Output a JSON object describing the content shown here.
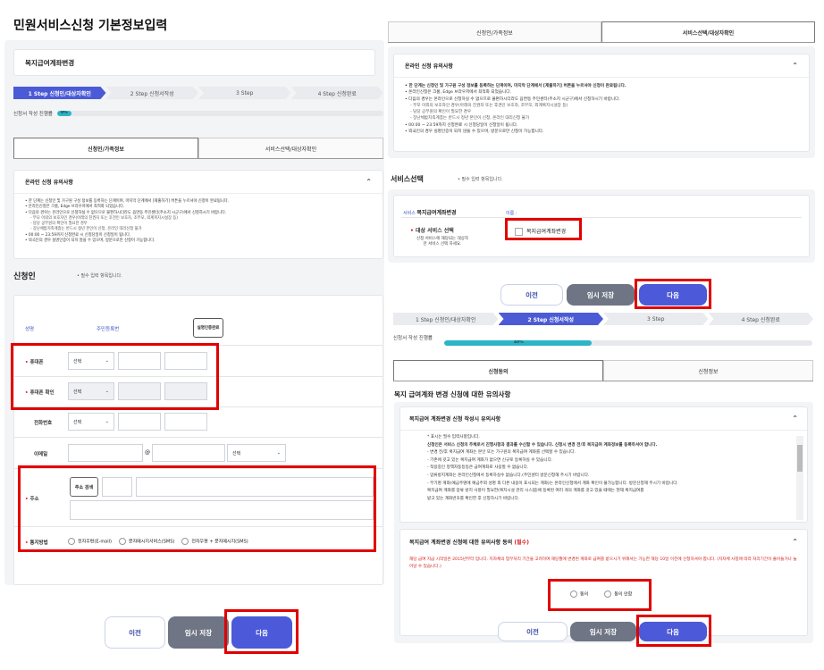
{
  "left": {
    "page_title": "민원서비스신청 기본정보입력",
    "service_name": "복지급여계좌변경",
    "steps": [
      "1 Step 신청인/대상자확인",
      "2 Step 신청서작성",
      "3 Step",
      "4 Step 신청완료"
    ],
    "progress_label": "신청서 작성 진행률",
    "progress_value": "0%",
    "tabs": [
      "신청인/가족정보",
      "서비스선택/대상자확인"
    ],
    "notice_title": "온라인 신청 유의사항",
    "notice_lines": [
      "한 단계는 신청인 및 가구원 구성 정보를 등록하는 단계이며, 마지막 단계에서 [제출하기] 버튼을 누르셔야 신청이 완료됩니다.",
      "온라인신청은 크롬, Edge 브라우저에서 최적화 되었습니다.",
      "다음의 경우는 온라인으로 신청하실 수 없으므로 불편하시더라도 읍면동 주민센터(주소지 시군구)에서 신청하시기 바랍니다.",
      "- 부모 이외의 보호자인 경우(아래의 친권자 또는 후견인 보호자, 조부모, 외계복지시설장 등)",
      "- 담당 공무원의 확인이 필요한 경우",
      "- 장난체밤지족계층는 반드시 정년 본인이 신청, 온라인 대리신청 불가",
      "00:00 ~ 23:59까지 신청완료 시 신청당일이 신청일이 됩니다.",
      "외국인의 경우 실명인증이 되지 않을 수 있으며, 방문으로만 신청이 가능합니다."
    ],
    "applicant_title": "신청인",
    "required_note": "• 필수 입력 항목입니다.",
    "form": {
      "name_label": "성명",
      "rrn_label": "주민등록번",
      "verify_button": "실명인증완료",
      "mobile_label": "휴대폰",
      "mobile_select": "선택",
      "mobile_confirm_label": "휴대폰 확인",
      "mobile_confirm_select": "선택",
      "phone_label": "전화번호",
      "phone_select": "선택",
      "email_label": "이메일",
      "email_at": "@",
      "email_select": "선택",
      "address_label": "주소",
      "address_button": "주소 검색",
      "notify_label": "통지방법",
      "notify_options": [
        "전자우편(E-mail)",
        "문자메시지서비스(SMS)",
        "전자우편 + 문자메시지(SMS)"
      ]
    },
    "buttons": {
      "prev": "이전",
      "temp": "임시 저장",
      "next": "다음"
    }
  },
  "right_top": {
    "tabs": [
      "신청인/가족정보",
      "서비스선택/대상자확인"
    ],
    "notice_title": "온라인 신청 유의사항",
    "notice_lines": [
      "한 단계는 신청인 및 가구원 구성 정보를 등록하는 단계이며, 마지막 단계에서 [제출하기] 버튼을 누르셔야 신청이 완료됩니다.",
      "온라인신청은 크롬, Edge 브라우저에서 최적화 되었습니다.",
      "다음의 경우는 온라인으로 신청하실 수 없으므로 불편하시더라도 읍면동 주민센터(주소지 시군구)에서 신청하시기 바랍니다.",
      "- 부모 이외의 보호자인 경우(아래의 친권자 또는 후견인 보호자, 조부모, 외계복지시설장 등)",
      "- 담당 공무원의 확인이 필요한 경우",
      "- 장난체밤지족계층는 반드시 정년 본인이 신청, 온라인 대리신청 불가",
      "00:00 ~ 23:59까지 신청완료 시 신청당일이 신청일이 됩니다.",
      "외국인의 경우 실명인증이 되지 않을 수 있으며, 방문으로만 신청이 가능합니다."
    ],
    "service_title": "서비스선택",
    "required_note": "• 필수 입력 항목입니다.",
    "service_small": "서비스",
    "service_name": "복지급여계좌변경",
    "name_small": "이름 :",
    "target_label": "대상 서비스 선택",
    "target_desc": "신청 서비스에 해당되는 대상자만 서비스 선택 하세요.",
    "target_option": "복지급여계좌변경",
    "buttons": {
      "prev": "이전",
      "temp": "임시 저장",
      "next": "다음"
    }
  },
  "right_bottom": {
    "steps": [
      "1 Step 신청인/대상자확인",
      "2 Step 신청서작성",
      "3 Step",
      "4 Step 신청완료"
    ],
    "progress_label": "신청서 작성 진행률",
    "progress_value": "40%",
    "progress_fraction": 0.4,
    "tabs": [
      "신청동의",
      "신청정보"
    ],
    "section_title": "복지 급여계좌 변경 신청에 대한 유의사항",
    "notice1_title": "복지급여 계좌변경 신청 작성시 유의사항",
    "notice1_lines": [
      "* 표시는 필수 입력사항입니다.",
      "신청인은 서비스 신청의 주체로서 진행사항과 결과를 수신할 수 있습니다. 신청시 변경 전/후 복지급여 계좌정보를 등록하셔야 합니다.",
      "- 변경 전/후 복지급여 계좌는 본인 또는 가구원의 복지급여 계좌를 선택할 수 있습니다.",
      "- 기존에 갖고 있는 복지급여 계좌가 없으면 신규로 등록하실 수 있습니다.",
      "- 적용중인 정액자동등등은 급여계좌로 사용할 수 없습니다.",
      "- 압류방지계좌는 온라인신청에서 등록하실수 없습니다.(주민센터 방문신청해 주시기 바랍니다.",
      "- 부기명 계좌(예금주명에 예금주외 성명 외 다른 내용이 표시되는 계좌)는 온라인신청에서 계좌 확인이 불가능합니다. 방문신청해 주시기 바랍니다.",
      "복지급여 계좌를 압류 방지 사항이 필요한(복지시설 관리 시스템)에 등록된 여러 개의 계좌를 갖고 있을 때에는 현재 복지급여를",
      "받고 있는 계좌번호를 확인한 후 신청하시기 바랍니다."
    ],
    "notice2_title": "복지급여 계좌변경 신청에 대한 유의사항 동의",
    "notice2_required": "(필수)",
    "notice2_text": "해당 급여 지급 시작일은 2015년부터 입니다. 지자체의 업무처리 기간을 고려하여 해당월에 변경된 계좌로 급여를 받으시기 위해서는 가능한 해당 10일 이전에 신청하셔야 합니다. (지자체 사정에 따라 처리기간이 줄어들거나 늘어날 수 있습니다.)",
    "agree": "동의",
    "disagree": "동의 안함",
    "buttons": {
      "prev": "이전",
      "temp": "임시 저장",
      "next": "다음"
    }
  },
  "colors": {
    "accent": "#4c59d8",
    "highlight": "#e10000",
    "progress_fill": "#2bb5c6"
  }
}
